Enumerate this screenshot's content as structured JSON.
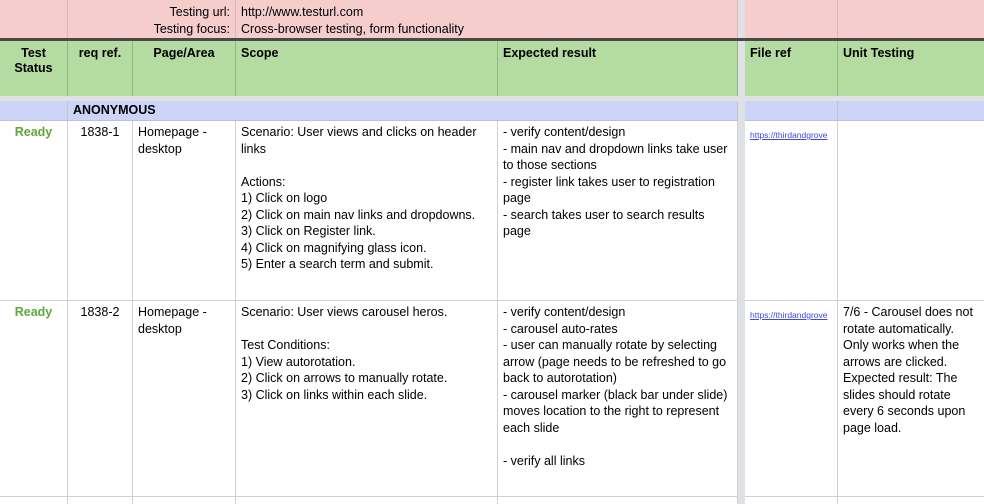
{
  "info_band": {
    "labels": [
      "Testing url:",
      "Testing focus:"
    ],
    "values": [
      "http://www.testurl.com",
      "Cross-browser testing, form functionality"
    ]
  },
  "columns": [
    {
      "key": "test_status",
      "label": "Test\nStatus"
    },
    {
      "key": "req_ref",
      "label": "req ref."
    },
    {
      "key": "page_area",
      "label": "Page/Area"
    },
    {
      "key": "scope",
      "label": "Scope"
    },
    {
      "key": "expected_result",
      "label": "Expected result"
    },
    {
      "key": "file_ref",
      "label": "File ref"
    },
    {
      "key": "unit_testing",
      "label": "Unit Testing"
    }
  ],
  "section_row": {
    "label": "ANONYMOUS"
  },
  "rows": [
    {
      "test_status": "Ready",
      "req_ref": "1838-1",
      "page_area": "Homepage - desktop",
      "scope": "Scenario: User views and clicks on header links\n\nActions:\n1) Click on logo\n2) Click on main nav links and dropdowns.\n3) Click on Register link.\n4) Click on magnifying glass icon.\n5) Enter a search term and submit.",
      "expected_result": "- verify content/design\n- main nav and dropdown links take user to those sections\n- register link takes user to registration page\n- search takes user to search results page",
      "file_ref": "https://thirdandgrove",
      "unit_testing": ""
    },
    {
      "test_status": "Ready",
      "req_ref": "1838-2",
      "page_area": "Homepage - desktop",
      "scope": "Scenario: User views carousel heros.\n\nTest Conditions:\n1) View autorotation.\n2) Click on arrows to manually rotate.\n3) Click on links within each slide.",
      "expected_result": "- verify content/design\n- carousel auto-rates\n- user can manually rotate by selecting arrow (page needs to be refreshed to go back to autorotation)\n- carousel marker (black bar under slide) moves location to the right to represent each slide\n\n- verify all links",
      "file_ref": "https://thirdandgrove",
      "unit_testing": "7/6 - Carousel does not rotate automatically. Only works when the arrows are clicked. Expected result: The slides should rotate every 6 seconds upon page load."
    }
  ],
  "colors": {
    "band_pink": "#f5cdcd",
    "header_green": "#b3dba2",
    "section_lavender": "#ccd5f8",
    "status_ready_green": "#5fa83a",
    "link_blue": "#3b4bdb",
    "divider_dark": "#4a4a4a",
    "gutter_gray": "#dfe1e5"
  }
}
